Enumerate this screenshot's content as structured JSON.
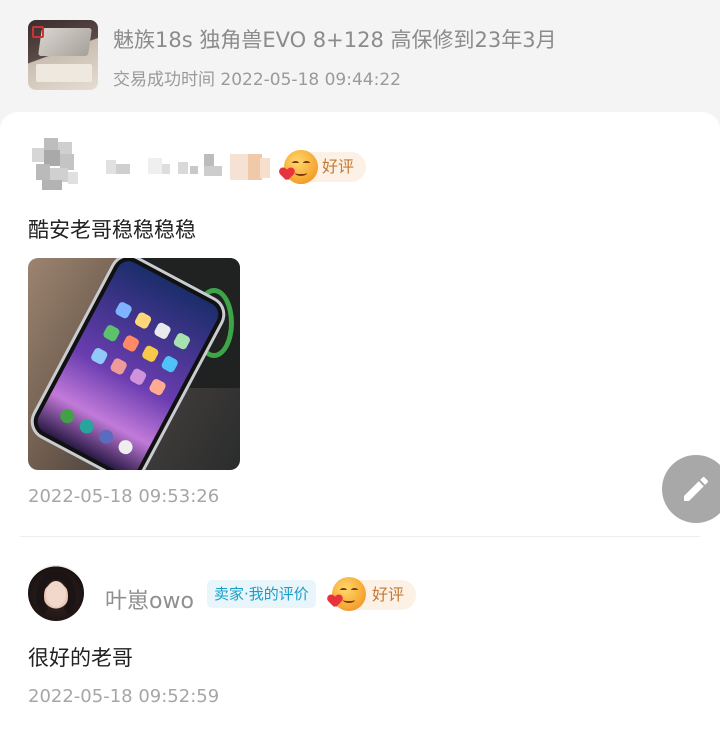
{
  "product": {
    "title": "魅族18s 独角兽EVO 8+128 高保修到23年3月",
    "trade_time": "交易成功时间 2022-05-18 09:44:22"
  },
  "reviews": [
    {
      "reviewer_name": "",
      "rating_label": "好评",
      "text": "酷安老哥稳稳稳稳",
      "has_photo": true,
      "time": "2022-05-18 09:53:26"
    },
    {
      "reviewer_name": "叶崽owo",
      "role_tag": "卖家·我的评价",
      "rating_label": "好评",
      "text": "很好的老哥",
      "time": "2022-05-18 09:52:59"
    }
  ],
  "icons": {
    "rating": "smiling-face-heart-icon",
    "fab": "pencil-edit-icon"
  },
  "colors": {
    "rating_text": "#c47a37",
    "seller_tag_text": "#1a9ec8",
    "fab_bg": "#a8a8a8"
  }
}
